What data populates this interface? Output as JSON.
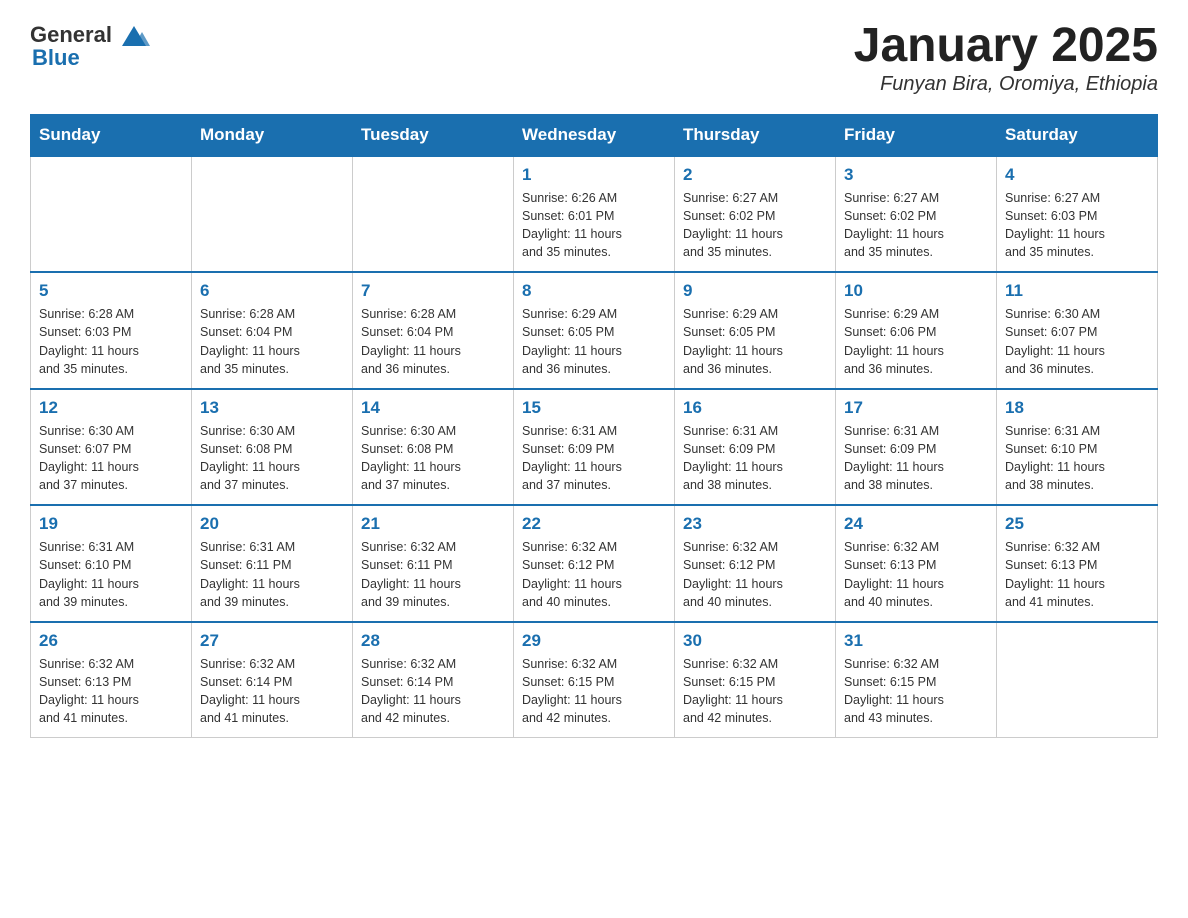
{
  "header": {
    "logo_general": "General",
    "logo_blue": "Blue",
    "month_title": "January 2025",
    "location": "Funyan Bira, Oromiya, Ethiopia"
  },
  "days_of_week": [
    "Sunday",
    "Monday",
    "Tuesday",
    "Wednesday",
    "Thursday",
    "Friday",
    "Saturday"
  ],
  "weeks": [
    [
      {
        "day": "",
        "info": ""
      },
      {
        "day": "",
        "info": ""
      },
      {
        "day": "",
        "info": ""
      },
      {
        "day": "1",
        "info": "Sunrise: 6:26 AM\nSunset: 6:01 PM\nDaylight: 11 hours\nand 35 minutes."
      },
      {
        "day": "2",
        "info": "Sunrise: 6:27 AM\nSunset: 6:02 PM\nDaylight: 11 hours\nand 35 minutes."
      },
      {
        "day": "3",
        "info": "Sunrise: 6:27 AM\nSunset: 6:02 PM\nDaylight: 11 hours\nand 35 minutes."
      },
      {
        "day": "4",
        "info": "Sunrise: 6:27 AM\nSunset: 6:03 PM\nDaylight: 11 hours\nand 35 minutes."
      }
    ],
    [
      {
        "day": "5",
        "info": "Sunrise: 6:28 AM\nSunset: 6:03 PM\nDaylight: 11 hours\nand 35 minutes."
      },
      {
        "day": "6",
        "info": "Sunrise: 6:28 AM\nSunset: 6:04 PM\nDaylight: 11 hours\nand 35 minutes."
      },
      {
        "day": "7",
        "info": "Sunrise: 6:28 AM\nSunset: 6:04 PM\nDaylight: 11 hours\nand 36 minutes."
      },
      {
        "day": "8",
        "info": "Sunrise: 6:29 AM\nSunset: 6:05 PM\nDaylight: 11 hours\nand 36 minutes."
      },
      {
        "day": "9",
        "info": "Sunrise: 6:29 AM\nSunset: 6:05 PM\nDaylight: 11 hours\nand 36 minutes."
      },
      {
        "day": "10",
        "info": "Sunrise: 6:29 AM\nSunset: 6:06 PM\nDaylight: 11 hours\nand 36 minutes."
      },
      {
        "day": "11",
        "info": "Sunrise: 6:30 AM\nSunset: 6:07 PM\nDaylight: 11 hours\nand 36 minutes."
      }
    ],
    [
      {
        "day": "12",
        "info": "Sunrise: 6:30 AM\nSunset: 6:07 PM\nDaylight: 11 hours\nand 37 minutes."
      },
      {
        "day": "13",
        "info": "Sunrise: 6:30 AM\nSunset: 6:08 PM\nDaylight: 11 hours\nand 37 minutes."
      },
      {
        "day": "14",
        "info": "Sunrise: 6:30 AM\nSunset: 6:08 PM\nDaylight: 11 hours\nand 37 minutes."
      },
      {
        "day": "15",
        "info": "Sunrise: 6:31 AM\nSunset: 6:09 PM\nDaylight: 11 hours\nand 37 minutes."
      },
      {
        "day": "16",
        "info": "Sunrise: 6:31 AM\nSunset: 6:09 PM\nDaylight: 11 hours\nand 38 minutes."
      },
      {
        "day": "17",
        "info": "Sunrise: 6:31 AM\nSunset: 6:09 PM\nDaylight: 11 hours\nand 38 minutes."
      },
      {
        "day": "18",
        "info": "Sunrise: 6:31 AM\nSunset: 6:10 PM\nDaylight: 11 hours\nand 38 minutes."
      }
    ],
    [
      {
        "day": "19",
        "info": "Sunrise: 6:31 AM\nSunset: 6:10 PM\nDaylight: 11 hours\nand 39 minutes."
      },
      {
        "day": "20",
        "info": "Sunrise: 6:31 AM\nSunset: 6:11 PM\nDaylight: 11 hours\nand 39 minutes."
      },
      {
        "day": "21",
        "info": "Sunrise: 6:32 AM\nSunset: 6:11 PM\nDaylight: 11 hours\nand 39 minutes."
      },
      {
        "day": "22",
        "info": "Sunrise: 6:32 AM\nSunset: 6:12 PM\nDaylight: 11 hours\nand 40 minutes."
      },
      {
        "day": "23",
        "info": "Sunrise: 6:32 AM\nSunset: 6:12 PM\nDaylight: 11 hours\nand 40 minutes."
      },
      {
        "day": "24",
        "info": "Sunrise: 6:32 AM\nSunset: 6:13 PM\nDaylight: 11 hours\nand 40 minutes."
      },
      {
        "day": "25",
        "info": "Sunrise: 6:32 AM\nSunset: 6:13 PM\nDaylight: 11 hours\nand 41 minutes."
      }
    ],
    [
      {
        "day": "26",
        "info": "Sunrise: 6:32 AM\nSunset: 6:13 PM\nDaylight: 11 hours\nand 41 minutes."
      },
      {
        "day": "27",
        "info": "Sunrise: 6:32 AM\nSunset: 6:14 PM\nDaylight: 11 hours\nand 41 minutes."
      },
      {
        "day": "28",
        "info": "Sunrise: 6:32 AM\nSunset: 6:14 PM\nDaylight: 11 hours\nand 42 minutes."
      },
      {
        "day": "29",
        "info": "Sunrise: 6:32 AM\nSunset: 6:15 PM\nDaylight: 11 hours\nand 42 minutes."
      },
      {
        "day": "30",
        "info": "Sunrise: 6:32 AM\nSunset: 6:15 PM\nDaylight: 11 hours\nand 42 minutes."
      },
      {
        "day": "31",
        "info": "Sunrise: 6:32 AM\nSunset: 6:15 PM\nDaylight: 11 hours\nand 43 minutes."
      },
      {
        "day": "",
        "info": ""
      }
    ]
  ]
}
